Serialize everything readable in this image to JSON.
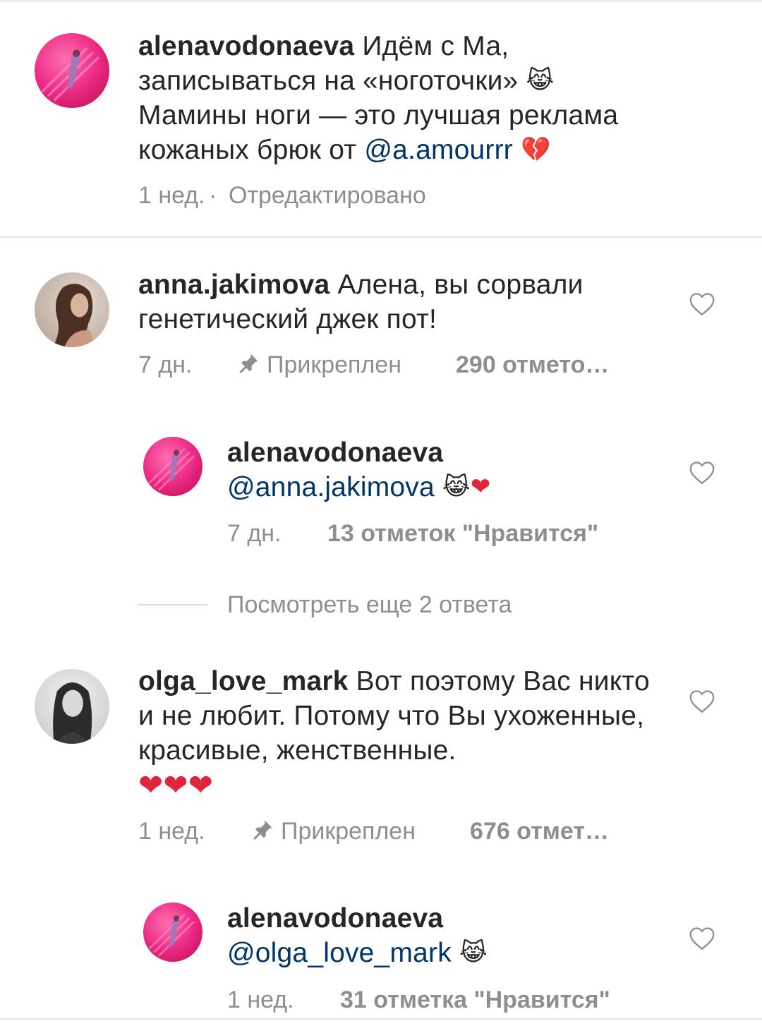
{
  "caption": {
    "username": "alenavodonaeva",
    "text_1": "Идём с Ма, записываться на «ноготочки»",
    "emoji_1": "😹",
    "text_2": "Мамины ноги — это лучшая реклама кожаных брюк от",
    "mention": "@a.amourrr",
    "emoji_2": "💔",
    "time": "1 нед.",
    "separator": "·",
    "edited": "Отредактировано"
  },
  "comments": [
    {
      "username": "anna.jakimova",
      "text": "Алена, вы сорвали генетический джек пот!",
      "time": "7 дн.",
      "pinned": "Прикреплен",
      "likes": "290 отмето…",
      "reply": {
        "username": "alenavodonaeva",
        "mention": "@anna.jakimova",
        "emoji": "😹",
        "emoji_2": "❤",
        "time": "7 дн.",
        "likes": "13 отметок \"Нравится\""
      }
    },
    {
      "username": "olga_love_mark",
      "text": "Вот поэтому Вас никто и не любит. Потому что Вы ухоженные, красивые, женственные.",
      "hearts": "❤❤❤",
      "time": "1 нед.",
      "pinned": "Прикреплен",
      "likes": "676 отмет…",
      "reply": {
        "username": "alenavodonaeva",
        "mention": "@olga_love_mark",
        "emoji": "😹",
        "time": "1 нед.",
        "likes": "31 отметка \"Нравится\""
      }
    }
  ],
  "view_more_replies": "Посмотреть еще 2 ответа",
  "icons": {
    "like": "heart-outline-icon",
    "pin": "pin-icon"
  },
  "colors": {
    "text": "#262626",
    "secondary": "#8e8e8e",
    "mention": "#003569",
    "avatar_pink": "#e8267a"
  }
}
